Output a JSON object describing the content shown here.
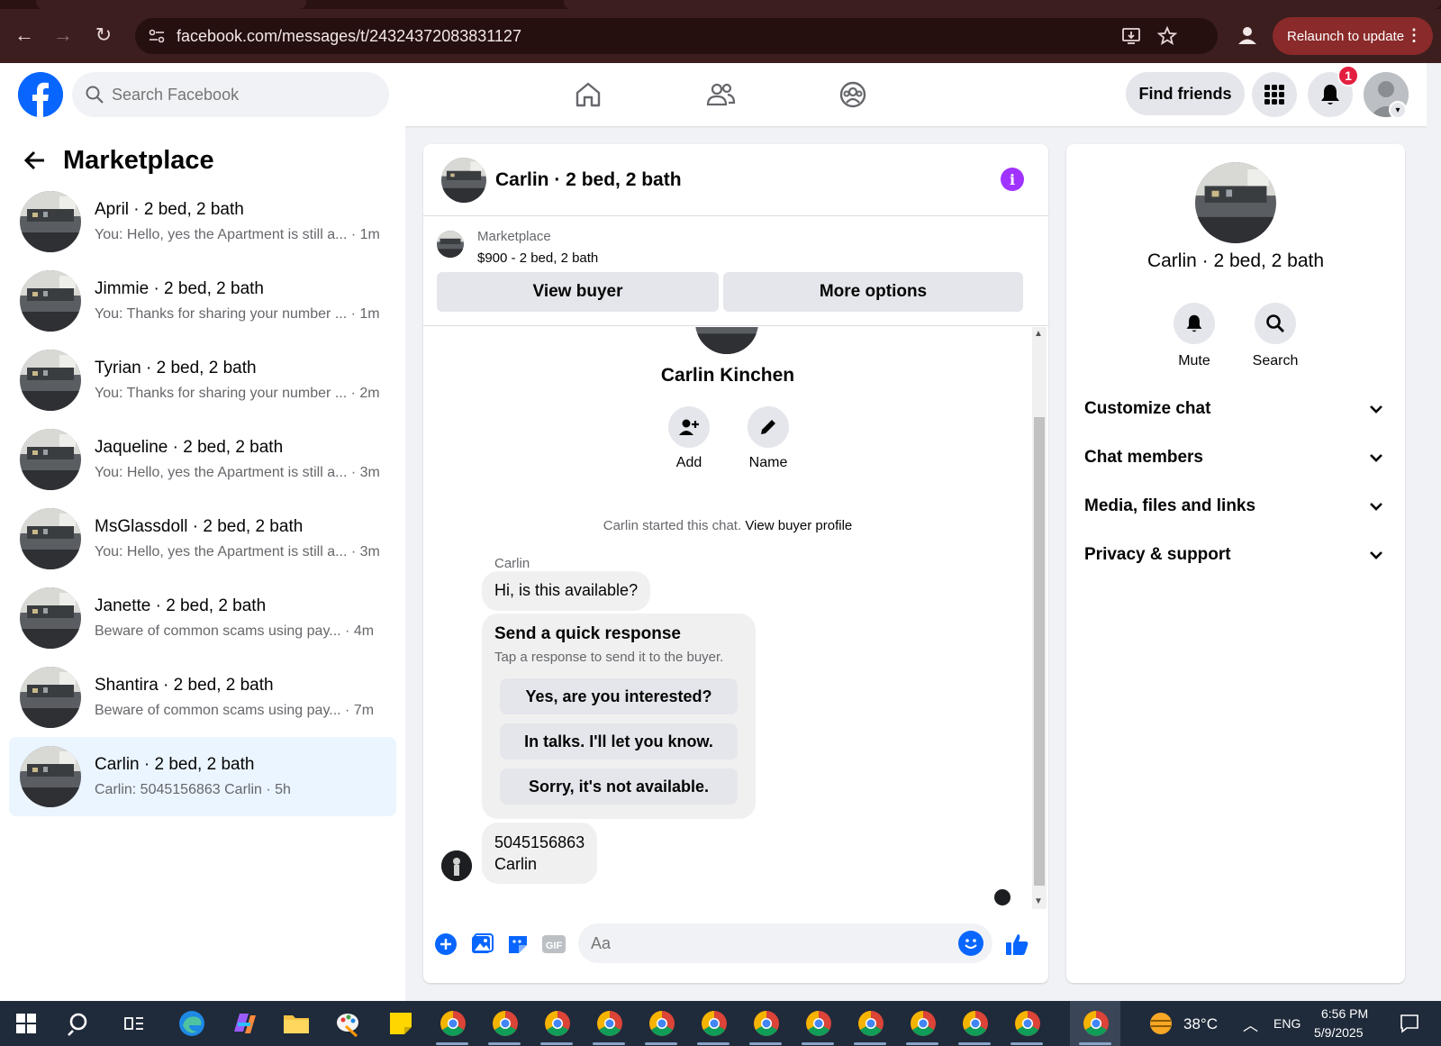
{
  "browser": {
    "url": "facebook.com/messages/t/24324372083831127",
    "relaunch_label": "Relaunch to update"
  },
  "topbar": {
    "search_placeholder": "Search Facebook",
    "find_friends_label": "Find friends",
    "notification_count": "1"
  },
  "sidebar": {
    "title": "Marketplace",
    "conversations": [
      {
        "title": "April · 2 bed, 2 bath",
        "preview": "You: Hello, yes the Apartment is still a... · 1m"
      },
      {
        "title": "Jimmie · 2 bed, 2 bath",
        "preview": "You: Thanks for sharing your number ... · 1m"
      },
      {
        "title": "Tyrian · 2 bed, 2 bath",
        "preview": "You: Thanks for sharing your number ... · 2m"
      },
      {
        "title": "Jaqueline · 2 bed, 2 bath",
        "preview": "You: Hello, yes the Apartment is still a... · 3m"
      },
      {
        "title": "MsGlassdoll · 2 bed, 2 bath",
        "preview": "You: Hello, yes the Apartment is still a... · 3m"
      },
      {
        "title": "Janette · 2 bed, 2 bath",
        "preview": "Beware of common scams using pay... · 4m"
      },
      {
        "title": "Shantira · 2 bed, 2 bath",
        "preview": "Beware of common scams using pay... · 7m"
      },
      {
        "title": "Carlin · 2 bed, 2 bath",
        "preview": "Carlin: 5045156863 Carlin · 5h"
      }
    ]
  },
  "chat": {
    "header_name": "Carlin · 2 bed, 2 bath",
    "listing_category": "Marketplace",
    "listing_price": "$900 - 2 bed, 2 bath",
    "view_buyer_label": "View buyer",
    "more_options_label": "More options",
    "profile_name": "Carlin Kinchen",
    "add_label": "Add",
    "name_label": "Name",
    "started_text": "Carlin started this chat.",
    "view_buyer_profile": "View buyer profile",
    "sender_name": "Carlin",
    "first_message": "Hi, is this available?",
    "quick_title": "Send a quick response",
    "quick_sub": "Tap a response to send it to the buyer.",
    "quick_responses": [
      "Yes, are you interested?",
      "In talks. I'll let you know.",
      "Sorry, it's not available."
    ],
    "message_line1": "5045156863",
    "message_line2": "Carlin",
    "composer_placeholder": "Aa"
  },
  "info_panel": {
    "name": "Carlin · 2 bed, 2 bath",
    "mute_label": "Mute",
    "search_label": "Search",
    "sections": [
      "Customize chat",
      "Chat members",
      "Media, files and links",
      "Privacy & support"
    ]
  },
  "taskbar": {
    "temperature": "38°C",
    "language": "ENG",
    "time": "6:56 PM",
    "date": "5/9/2025"
  },
  "colors": {
    "facebook_blue": "#0866ff",
    "info_purple": "#a033ff",
    "notification_red": "#e41e3f",
    "active_conversation": "#ebf5ff"
  }
}
